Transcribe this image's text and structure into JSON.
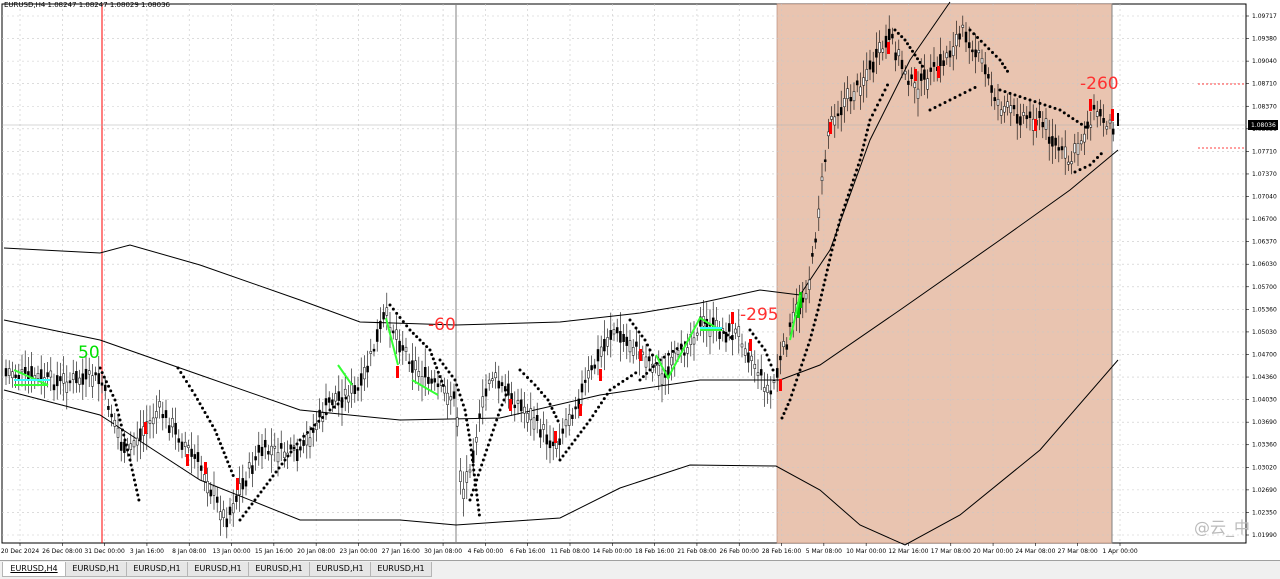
{
  "window": {
    "symbol_info": "EURUSD,H4  1.08247 1.08247 1.08029 1.08036"
  },
  "chart_data": {
    "type": "candlestick",
    "symbol": "EURUSD",
    "timeframe": "H4",
    "ohlc_current": {
      "open": 1.08247,
      "high": 1.08247,
      "low": 1.08029,
      "close": 1.08036
    },
    "current_price_label": "1.08036",
    "y_ticks": [
      "1.09717",
      "1.09380",
      "1.09040",
      "1.08710",
      "1.08370",
      "1.08036",
      "1.07710",
      "1.07370",
      "1.07040",
      "1.06700",
      "1.06370",
      "1.06030",
      "1.05700",
      "1.05360",
      "1.05030",
      "1.04700",
      "1.04360",
      "1.04030",
      "1.03690",
      "1.03360",
      "1.03020",
      "1.02690",
      "1.02350",
      "1.01990"
    ],
    "x_ticks": [
      "20 Dec 2024",
      "26 Dec 08:00",
      "31 Dec 00:00",
      "3 Jan 16:00",
      "8 Jan 08:00",
      "13 Jan 00:00",
      "15 Jan 16:00",
      "20 Jan 08:00",
      "23 Jan 00:00",
      "27 Jan 16:00",
      "30 Jan 08:00",
      "4 Feb 00:00",
      "6 Feb 16:00",
      "11 Feb 08:00",
      "14 Feb 00:00",
      "18 Feb 16:00",
      "21 Feb 08:00",
      "26 Feb 00:00",
      "28 Feb 16:00",
      "5 Mar 08:00",
      "10 Mar 00:00",
      "12 Mar 16:00",
      "17 Mar 08:00",
      "20 Mar 00:00",
      "24 Mar 08:00",
      "27 Mar 08:00",
      "1 Apr 00:00"
    ],
    "annotations": [
      {
        "text": "50",
        "color": "#00e000"
      },
      {
        "text": "-60",
        "color": "#ff3030"
      },
      {
        "text": "-295",
        "color": "#ff3030"
      },
      {
        "text": "-260",
        "color": "#ff3030"
      }
    ],
    "indicators": [
      "Bollinger-style envelope bands",
      "Parabolic SAR dots",
      "Zigzag lines"
    ],
    "shaded_period": "28 Feb 16:00 - 1 Apr 00:00",
    "colors": {
      "shade": "#e9c4b0",
      "bull_marker": "#00cc00",
      "bear_marker": "#ff0000",
      "zigzag": "#33ff33",
      "zigzag_alt": "#33ffff",
      "vline_red": "#ff0000"
    }
  },
  "tabs": [
    {
      "label": "EURUSD,H4",
      "active": true
    },
    {
      "label": "EURUSD,H1",
      "active": false
    },
    {
      "label": "EURUSD,H1",
      "active": false
    },
    {
      "label": "EURUSD,H1",
      "active": false
    },
    {
      "label": "EURUSD,H1",
      "active": false
    },
    {
      "label": "EURUSD,H1",
      "active": false
    },
    {
      "label": "EURUSD,H1",
      "active": false
    }
  ],
  "watermark": "@云_中"
}
